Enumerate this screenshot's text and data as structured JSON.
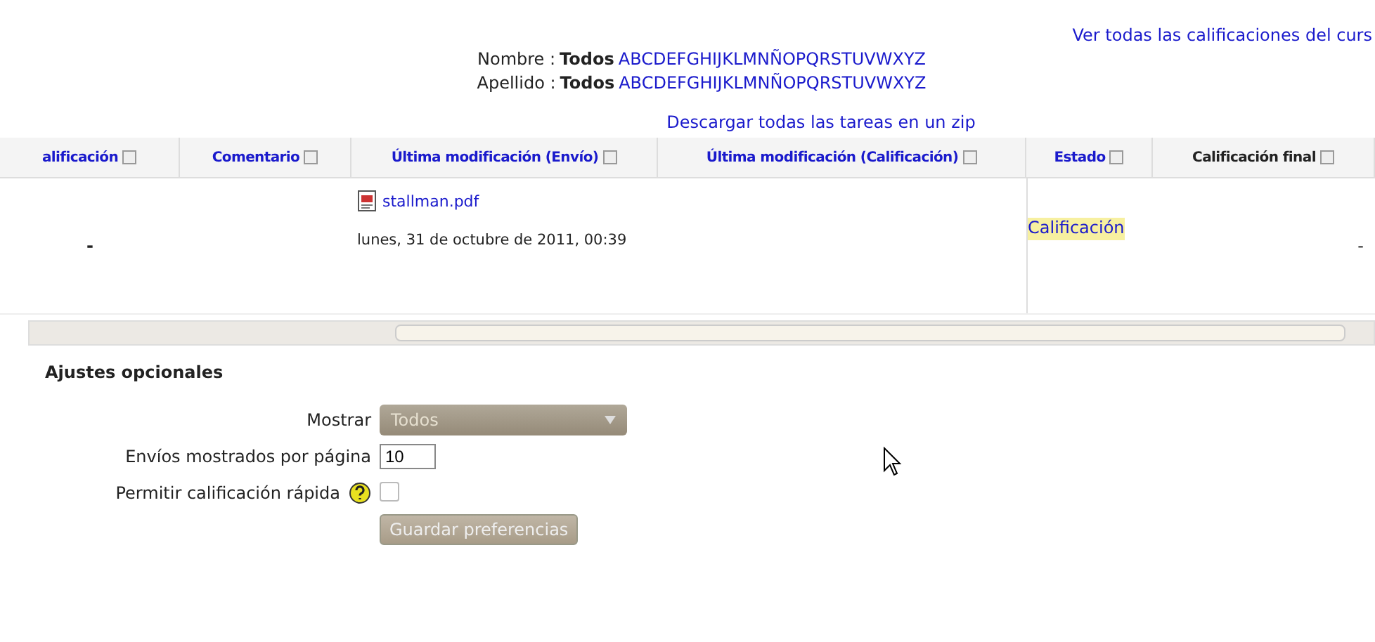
{
  "top_link": "Ver todas las calificaciones del curs",
  "filters": [
    {
      "label": "Nombre :",
      "all": "Todos",
      "letters": "ABCDEFGHIJKLMNÑOPQRSTUVWXYZ"
    },
    {
      "label": "Apellido :",
      "all": "Todos",
      "letters": "ABCDEFGHIJKLMNÑOPQRSTUVWXYZ"
    }
  ],
  "download_link": "Descargar todas las tareas en un zip",
  "table": {
    "columns": [
      {
        "label": "alificación",
        "kind": "link"
      },
      {
        "label": "Comentario",
        "kind": "link"
      },
      {
        "label": "Última modificación (Envío)",
        "kind": "link"
      },
      {
        "label": "Última modificación (Calificación)",
        "kind": "link"
      },
      {
        "label": "Estado",
        "kind": "link"
      },
      {
        "label": "Calificación final",
        "kind": "plain"
      }
    ],
    "rows": [
      {
        "grade": "-",
        "file": "stallman.pdf",
        "submitted": "lunes, 31 de octubre de 2011, 00:39",
        "status": "Calificación",
        "final": "-"
      }
    ]
  },
  "settings": {
    "title": "Ajustes opcionales",
    "show_label": "Mostrar",
    "show_value": "Todos",
    "per_page_label": "Envíos mostrados por página",
    "per_page_value": "10",
    "quick_label": "Permitir calificación rápida",
    "quick_checked": false,
    "save": "Guardar preferencias"
  }
}
